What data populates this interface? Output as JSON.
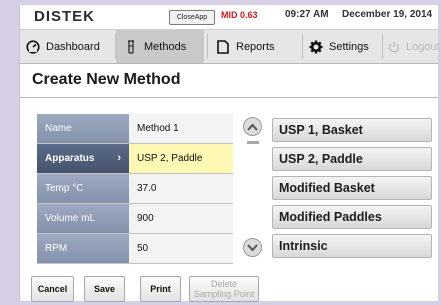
{
  "status": {
    "brand": "DISTEK",
    "close_app": "CloseApp",
    "mid": "MID 0.63",
    "time": "09:27 AM",
    "date": "December 19, 2014"
  },
  "nav": {
    "tabs": [
      {
        "label": "Dashboard",
        "icon": "gauge-icon",
        "active": false
      },
      {
        "label": "Methods",
        "icon": "flask-icon",
        "active": true
      },
      {
        "label": "Reports",
        "icon": "document-icon",
        "active": false
      },
      {
        "label": "Settings",
        "icon": "gear-icon",
        "active": false
      },
      {
        "label": "Logout",
        "icon": "power-icon",
        "enabled": false
      }
    ]
  },
  "page_title": "Create New Method",
  "form": {
    "rows": [
      {
        "label": "Name",
        "value": "Method 1"
      },
      {
        "label": "Apparatus",
        "value": "USP 2, Paddle",
        "selected": true
      },
      {
        "label": "Temp °C",
        "value": "37.0"
      },
      {
        "label": "Volume mL",
        "value": "900"
      },
      {
        "label": "RPM",
        "value": "50"
      }
    ]
  },
  "options": [
    "USP 1, Basket",
    "USP 2, Paddle",
    "Modified Basket",
    "Modified Paddles",
    "Intrinsic"
  ],
  "actions": {
    "cancel": "Cancel",
    "save": "Save",
    "print": "Print",
    "delete_line1": "Delete",
    "delete_line2": "Sampling Point"
  },
  "colors": {
    "selected_value_bg": "#fdf8b4",
    "label_bg": "#8f9cb5",
    "mid_text": "#d21a1a"
  }
}
